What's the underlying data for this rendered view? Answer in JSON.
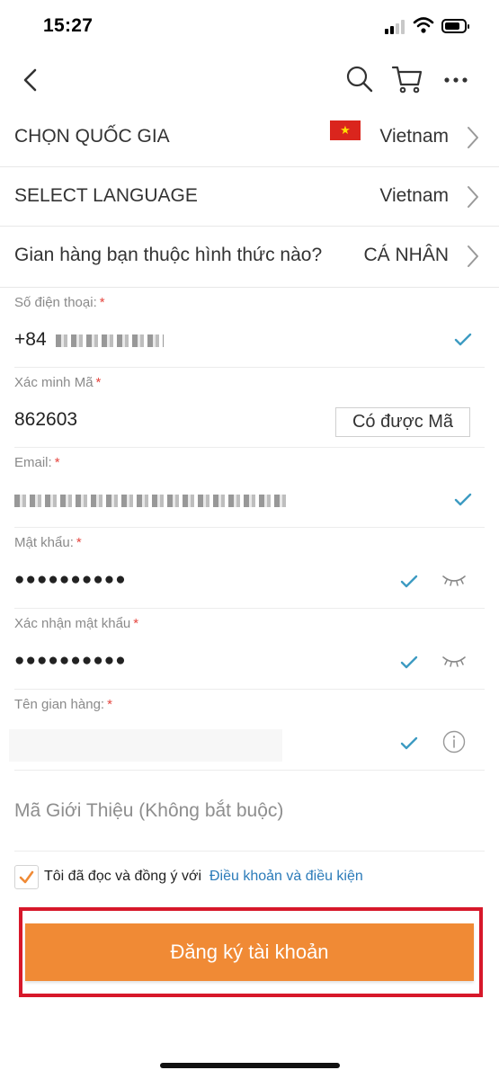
{
  "status_bar": {
    "time": "15:27",
    "signal_bars_active": 2,
    "signal_bars_total": 4,
    "battery_level": 0.6
  },
  "icons": {
    "back": "chevron-left-icon",
    "search": "search-icon",
    "cart": "cart-icon",
    "more": "more-horizontal-icon"
  },
  "settings": {
    "country": {
      "label": "CHỌN QUỐC GIA",
      "value": "Vietnam",
      "flag": "vietnam-flag"
    },
    "language": {
      "label": "SELECT LANGUAGE",
      "value": "Vietnam"
    },
    "shop_type": {
      "label": "Gian hàng bạn thuộc hình thức nào?",
      "value": "CÁ NHÂN"
    }
  },
  "form": {
    "required_mark": "*",
    "phone": {
      "label": "Số điện thoại:",
      "prefix": "+84"
    },
    "verify_code": {
      "label": "Xác minh Mã",
      "value": "862603",
      "button": "Có được Mã"
    },
    "email": {
      "label": "Email:"
    },
    "password": {
      "label": "Mật khẩu:",
      "value": "●●●●●●●●●●"
    },
    "confirm_password": {
      "label": "Xác nhận mật khẩu",
      "value": "●●●●●●●●●●"
    },
    "shop_name": {
      "label": "Tên gian hàng:"
    },
    "referral": {
      "placeholder": "Mã Giới Thiệu (Không bắt buộc)"
    }
  },
  "agreement": {
    "checked": true,
    "text": "Tôi đã đọc và đồng ý với",
    "link": "Điều khoản và điều kiện"
  },
  "register_button": "Đăng ký tài khoản",
  "colors": {
    "accent": "#f08a35",
    "link": "#2b7bb9",
    "check": "#3d9bc2",
    "highlight": "#d7182a",
    "required": "#e5463f"
  }
}
